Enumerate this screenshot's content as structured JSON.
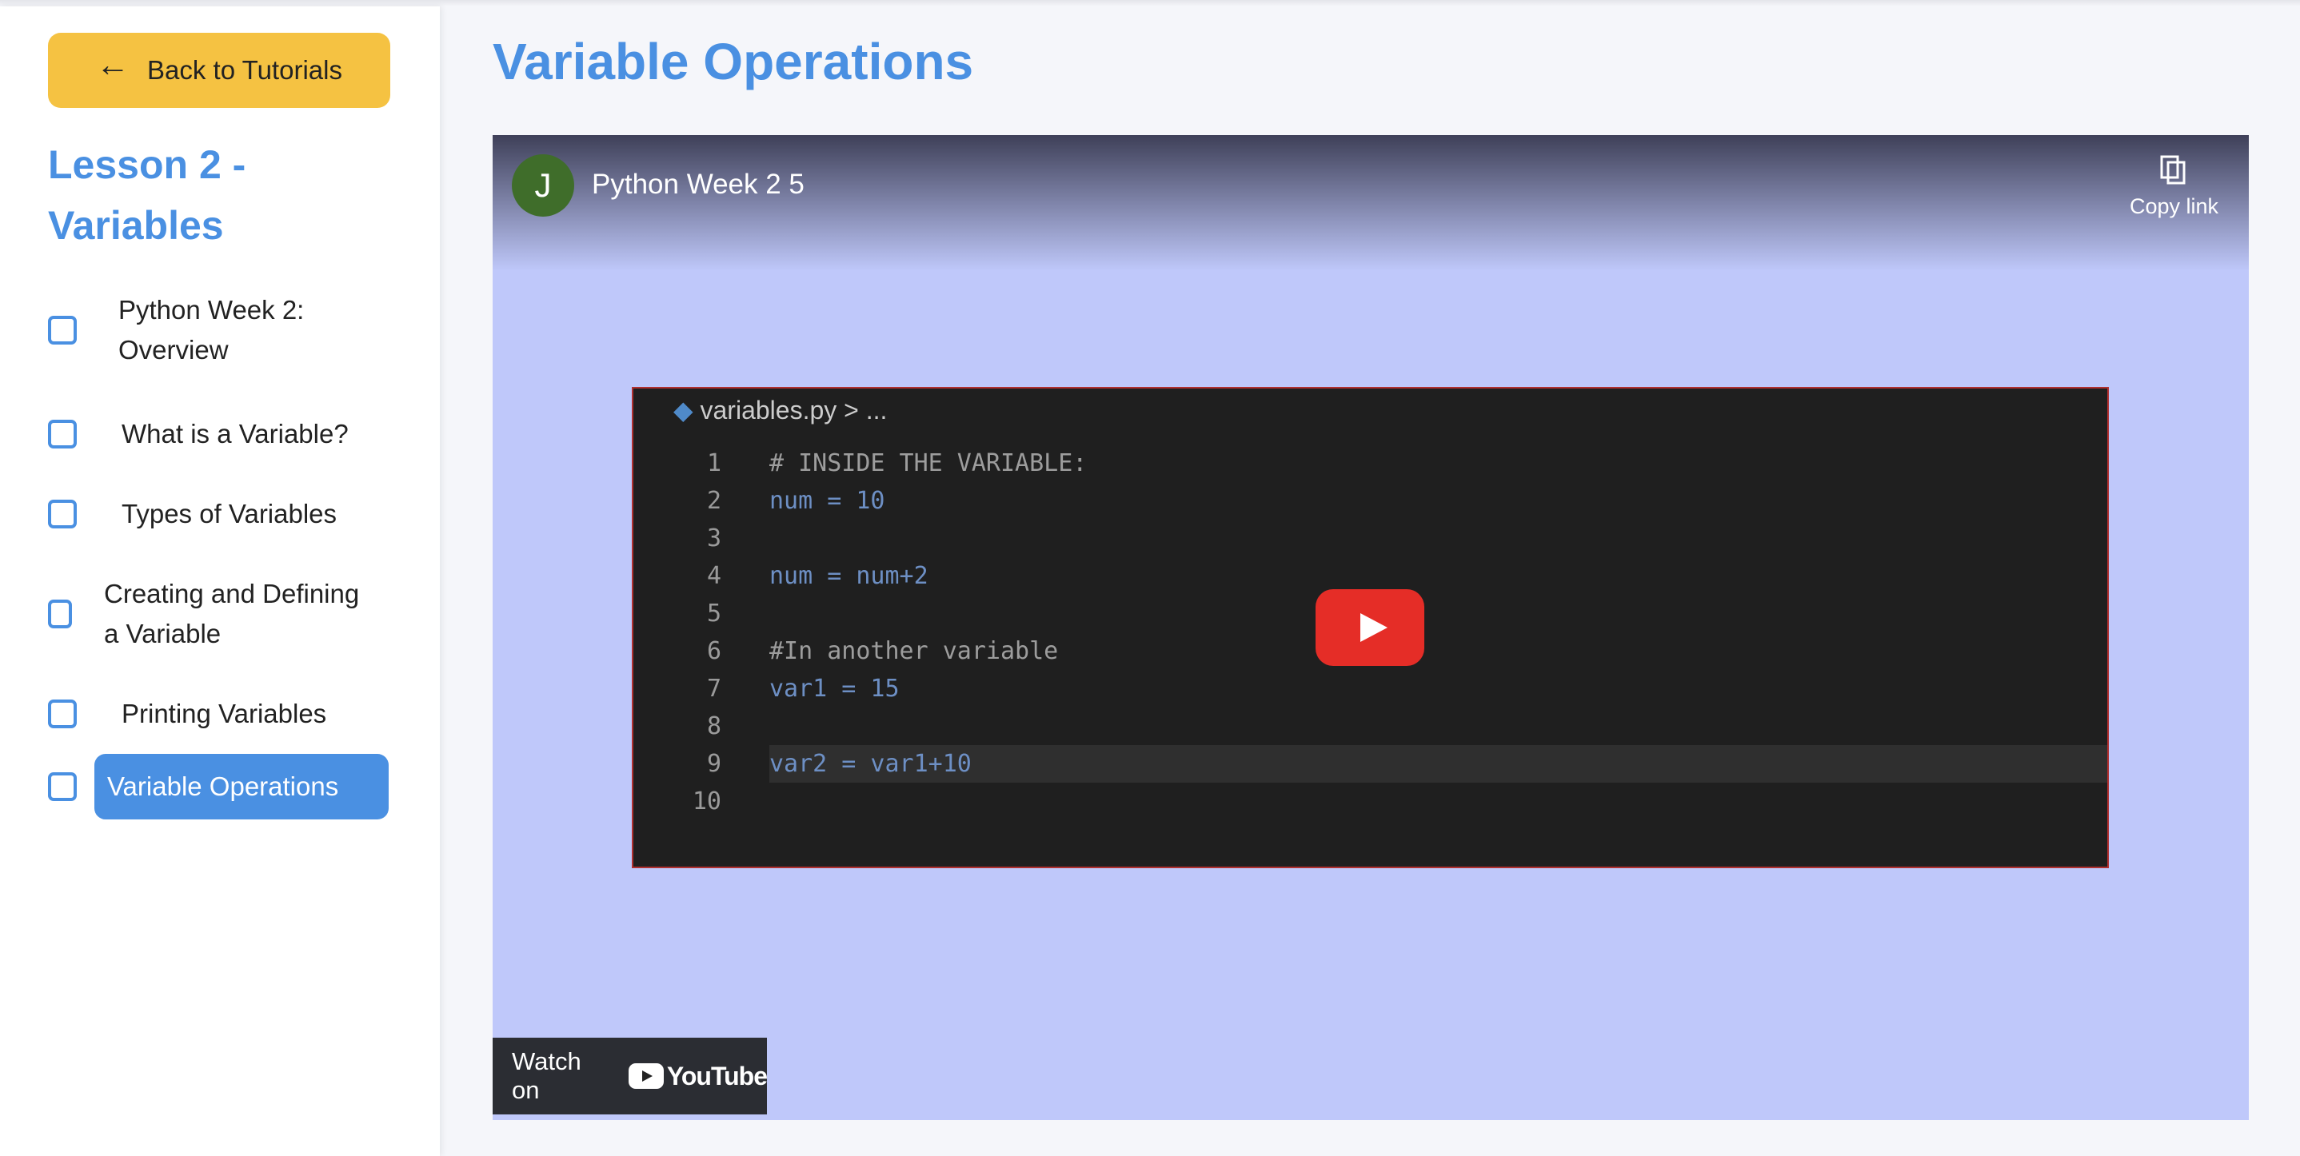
{
  "sidebar": {
    "back_label": "Back to Tutorials",
    "lesson_title": "Lesson 2 - Variables",
    "items": [
      {
        "label": "Python Week 2: Overview",
        "checked": false
      },
      {
        "label": "What is a Variable?",
        "checked": false
      },
      {
        "label": "Types of Variables",
        "checked": false
      },
      {
        "label": "Creating and Defining a Variable",
        "checked": false
      },
      {
        "label": "Printing Variables",
        "checked": false
      },
      {
        "label": "Variable Operations",
        "checked": false,
        "active": true
      }
    ]
  },
  "main": {
    "title": "Variable Operations",
    "video": {
      "channel_initial": "J",
      "title": "Python Week 2 5",
      "copy_link": "Copy link",
      "watch_on": "Watch on",
      "youtube": "YouTube",
      "code": {
        "breadcrumb": "variables.py > ...",
        "lines": [
          "# INSIDE THE VARIABLE:",
          "num = 10",
          "",
          "num = num+2",
          "",
          "#In another variable",
          "var1 = 15",
          "",
          "var2 = var1+10",
          ""
        ]
      }
    }
  },
  "colors": {
    "accent": "#4a90e2",
    "back_button": "#f5c242",
    "video_bg": "#bfc8fa",
    "youtube_red": "#e52d27"
  }
}
